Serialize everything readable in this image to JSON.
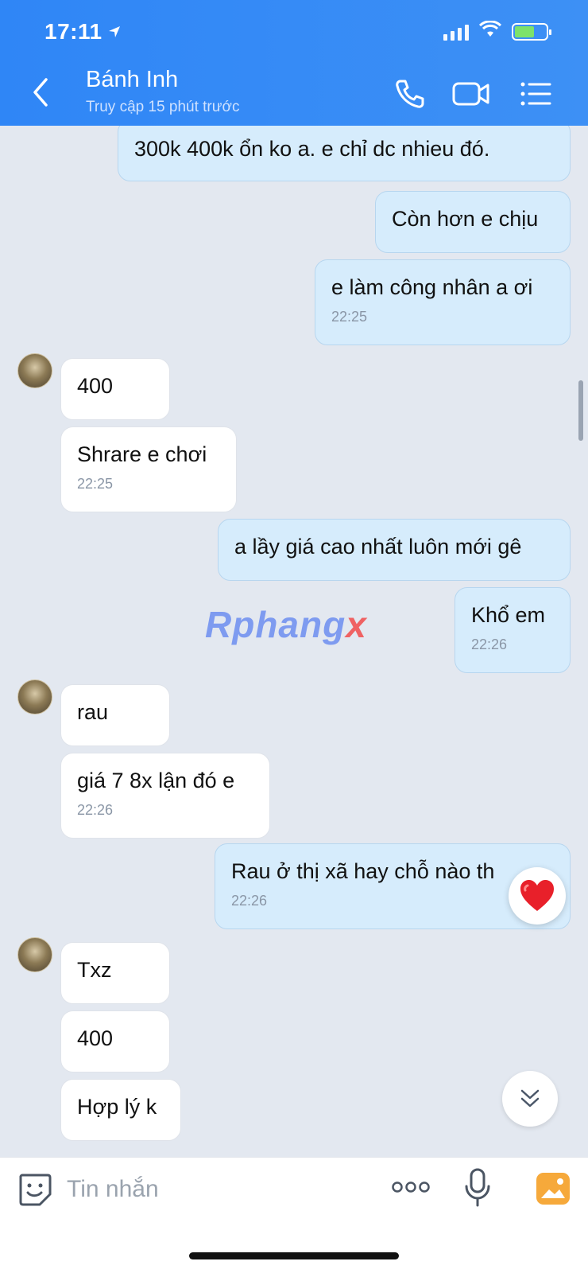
{
  "status_bar": {
    "time": "17:11"
  },
  "header": {
    "contact_name": "Bánh Inh",
    "last_seen": "Truy cập 15 phút trước"
  },
  "watermark": {
    "text": "Rphang",
    "accent": "x"
  },
  "messages": [
    {
      "side": "out",
      "text": "300k 400k ổn ko a.  e chỉ dc nhieu đó.",
      "time": ""
    },
    {
      "side": "out",
      "text": "Còn hơn e chịu",
      "time": ""
    },
    {
      "side": "out",
      "text": "e làm công nhân a ơi",
      "time": "22:25"
    },
    {
      "side": "in",
      "text": "400",
      "time": ""
    },
    {
      "side": "in",
      "text": "Shrare e chơi",
      "time": "22:25"
    },
    {
      "side": "out",
      "text": "a lầy giá cao nhất luôn mới gê",
      "time": ""
    },
    {
      "side": "out",
      "text": "Khổ em",
      "time": "22:26"
    },
    {
      "side": "in",
      "text": "rau",
      "time": ""
    },
    {
      "side": "in",
      "text": "giá 7 8x lận đó e",
      "time": "22:26"
    },
    {
      "side": "out",
      "text": "Rau ở thị xã hay chỗ nào th",
      "time": "22:26"
    },
    {
      "side": "in",
      "text": "Txz",
      "time": ""
    },
    {
      "side": "in",
      "text": "400",
      "time": ""
    },
    {
      "side": "in",
      "text": "Hợp lý k",
      "time": ""
    }
  ],
  "composer": {
    "placeholder": "Tin nhắn"
  },
  "colors": {
    "header_blue": "#2f86f6",
    "outgoing_bubble": "#d6ecfc",
    "incoming_bubble": "#ffffff",
    "chat_bg": "#e3e8f0"
  }
}
